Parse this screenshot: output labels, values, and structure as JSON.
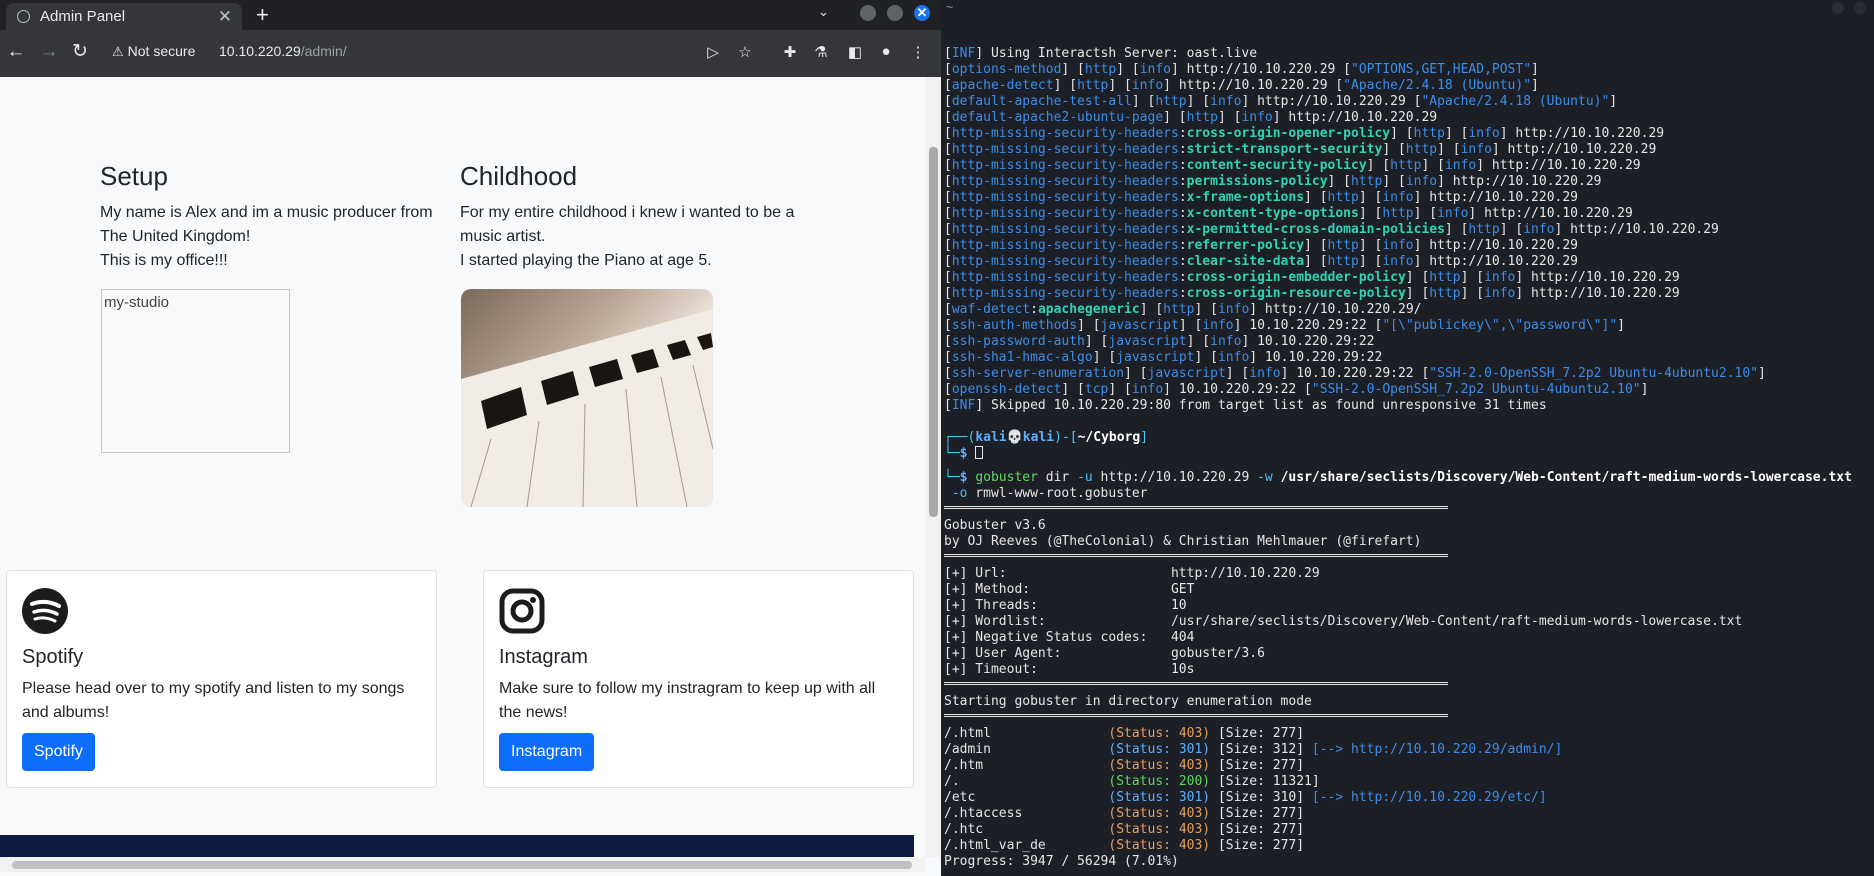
{
  "browser": {
    "tab_title": "Admin Panel",
    "security_label": "Not secure",
    "url_host": "10.10.220.29",
    "url_path": "/admin/"
  },
  "page": {
    "setup": {
      "title": "Setup",
      "lines": [
        "My name is Alex and im a music producer from",
        "The United Kingdom!",
        "This is my office!!!"
      ],
      "image_alt": "my-studio"
    },
    "childhood": {
      "title": "Childhood",
      "lines": [
        "For my entire childhood i knew i wanted to be a",
        "music artist.",
        "I started playing the Piano at age 5."
      ]
    },
    "spotify": {
      "title": "Spotify",
      "text_lines": [
        "Please head over to my spotify and listen to my songs",
        "and albums!"
      ],
      "button": "Spotify"
    },
    "instagram": {
      "title": "Instagram",
      "text_lines": [
        "Make sure to follow my instragram to keep up with all",
        "the news!"
      ],
      "button": "Instagram"
    }
  },
  "terminal": {
    "title_char": "~",
    "lines": [
      "[INF] Using Interactsh Server: oast.live",
      "[options-method] [http] [info] http://10.10.220.29 [\"OPTIONS,GET,HEAD,POST\"]",
      "[apache-detect] [http] [info] http://10.10.220.29 [\"Apache/2.4.18 (Ubuntu)\"]",
      "[default-apache-test-all] [http] [info] http://10.10.220.29 [\"Apache/2.4.18 (Ubuntu)\"]",
      "[default-apache2-ubuntu-page] [http] [info] http://10.10.220.29",
      "[http-missing-security-headers:cross-origin-opener-policy] [http] [info] http://10.10.220.29",
      "[http-missing-security-headers:strict-transport-security] [http] [info] http://10.10.220.29",
      "[http-missing-security-headers:content-security-policy] [http] [info] http://10.10.220.29",
      "[http-missing-security-headers:permissions-policy] [http] [info] http://10.10.220.29",
      "[http-missing-security-headers:x-frame-options] [http] [info] http://10.10.220.29",
      "[http-missing-security-headers:x-content-type-options] [http] [info] http://10.10.220.29",
      "[http-missing-security-headers:x-permitted-cross-domain-policies] [http] [info] http://10.10.220.29",
      "[http-missing-security-headers:referrer-policy] [http] [info] http://10.10.220.29",
      "[http-missing-security-headers:clear-site-data] [http] [info] http://10.10.220.29",
      "[http-missing-security-headers:cross-origin-embedder-policy] [http] [info] http://10.10.220.29",
      "[http-missing-security-headers:cross-origin-resource-policy] [http] [info] http://10.10.220.29",
      "[waf-detect:apachegeneric] [http] [info] http://10.10.220.29/",
      "[ssh-auth-methods] [javascript] [info] 10.10.220.29:22 [\"[\\\"publickey\\\",\\\"password\\\"]\"]",
      "[ssh-password-auth] [javascript] [info] 10.10.220.29:22",
      "[ssh-sha1-hmac-algo] [javascript] [info] 10.10.220.29:22",
      "[ssh-server-enumeration] [javascript] [info] 10.10.220.29:22 [\"SSH-2.0-OpenSSH_7.2p2 Ubuntu-4ubuntu2.10\"]",
      "[openssh-detect] [tcp] [info] 10.10.220.29:22 [\"SSH-2.0-OpenSSH_7.2p2 Ubuntu-4ubuntu2.10\"]",
      "[INF] Skipped 10.10.220.29:80 from target list as found unresponsive 31 times"
    ],
    "prompt": {
      "user": "kali",
      "host": "kali",
      "dir": "~/Cyborg"
    },
    "command_1": "gobuster dir -u http://10.10.220.29 -w /usr/share/seclists/Discovery/Web-Content/raft-medium-words-lowercase.txt",
    "command_2": " -o rmwl-www-root.gobuster",
    "banner": [
      "Gobuster v3.6",
      "by OJ Reeves (@TheColonial) & Christian Mehlmauer (@firefart)"
    ],
    "config": [
      {
        "k": "[+] Url:",
        "v": "http://10.10.220.29"
      },
      {
        "k": "[+] Method:",
        "v": "GET"
      },
      {
        "k": "[+] Threads:",
        "v": "10"
      },
      {
        "k": "[+] Wordlist:",
        "v": "/usr/share/seclists/Discovery/Web-Content/raft-medium-words-lowercase.txt"
      },
      {
        "k": "[+] Negative Status codes:",
        "v": "404"
      },
      {
        "k": "[+] User Agent:",
        "v": "gobuster/3.6"
      },
      {
        "k": "[+] Timeout:",
        "v": "10s"
      }
    ],
    "start_msg": "Starting gobuster in directory enumeration mode",
    "results": [
      {
        "path": "/.html",
        "status": "403",
        "size": "277",
        "redirect": ""
      },
      {
        "path": "/admin",
        "status": "301",
        "size": "312",
        "redirect": "http://10.10.220.29/admin/"
      },
      {
        "path": "/.htm",
        "status": "403",
        "size": "277",
        "redirect": ""
      },
      {
        "path": "/.",
        "status": "200",
        "size": "11321",
        "redirect": ""
      },
      {
        "path": "/etc",
        "status": "301",
        "size": "310",
        "redirect": "http://10.10.220.29/etc/"
      },
      {
        "path": "/.htaccess",
        "status": "403",
        "size": "277",
        "redirect": ""
      },
      {
        "path": "/.htc",
        "status": "403",
        "size": "277",
        "redirect": ""
      },
      {
        "path": "/.html_var_de",
        "status": "403",
        "size": "277",
        "redirect": ""
      }
    ],
    "progress": "Progress: 3947 / 56294 (7.01%)"
  }
}
